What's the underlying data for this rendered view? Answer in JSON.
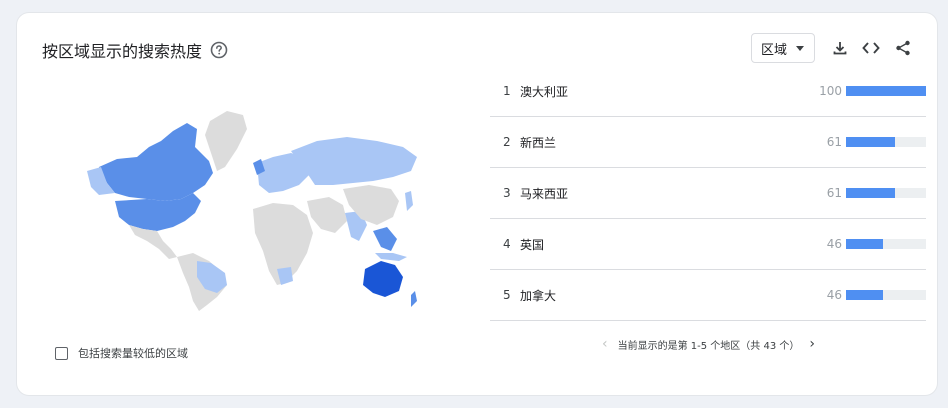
{
  "header": {
    "title": "按区域显示的搜索热度",
    "region_select": "区域"
  },
  "list": {
    "rows": [
      {
        "rank": "1",
        "name": "澳大利亚",
        "score": "100",
        "value": 100
      },
      {
        "rank": "2",
        "name": "新西兰",
        "score": "61",
        "value": 61
      },
      {
        "rank": "3",
        "name": "马来西亚",
        "score": "61",
        "value": 61
      },
      {
        "rank": "4",
        "name": "英国",
        "score": "46",
        "value": 46
      },
      {
        "rank": "5",
        "name": "加拿大",
        "score": "46",
        "value": 46
      }
    ]
  },
  "footer": {
    "checkbox_label": "包括搜索量较低的区域",
    "pagination": "当前显示的是第 1-5 个地区（共 43 个）"
  },
  "colors": {
    "bar_fill": "#4f8ff2",
    "bar_track": "#eceff1",
    "map_strong": "#1a56d6",
    "map_mid": "#5a8fe8",
    "map_light": "#a9c6f5",
    "map_none": "#dcdcdc"
  },
  "icons": [
    "help-icon",
    "download-icon",
    "embed-code-icon",
    "share-icon",
    "chevron-left-icon",
    "chevron-right-icon"
  ]
}
